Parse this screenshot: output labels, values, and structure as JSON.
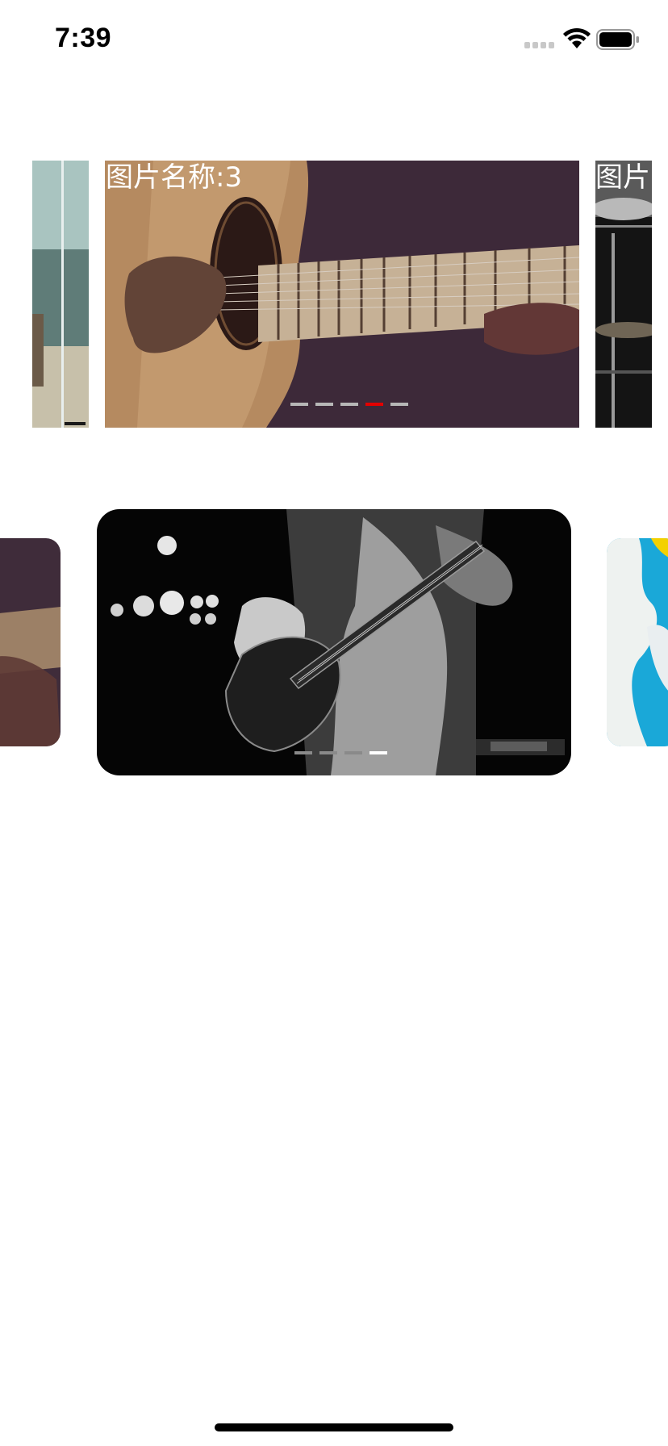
{
  "status_bar": {
    "time": "7:39",
    "signal_icon": "cellular-signal-icon",
    "wifi_icon": "wifi-icon",
    "battery_icon": "battery-icon"
  },
  "carousel_1": {
    "slides": [
      {
        "image": "train-station-photo"
      },
      {
        "image": "acoustic-guitar-photo",
        "caption": "图片名称:3"
      },
      {
        "image": "drum-kit-photo",
        "caption": "图片"
      }
    ],
    "page_count": 5,
    "current_page": 4,
    "active_dot_color": "#e30000",
    "inactive_dot_color": "#b7b7b7"
  },
  "carousel_2": {
    "slides": [
      {
        "image": "acoustic-guitar-photo"
      },
      {
        "image": "electric-guitar-player-photo"
      },
      {
        "image": "sky-clouds-photo"
      }
    ],
    "page_count": 4,
    "current_page": 4,
    "active_dot_color": "#ffffff",
    "inactive_dot_color": "#8a8a8a"
  }
}
